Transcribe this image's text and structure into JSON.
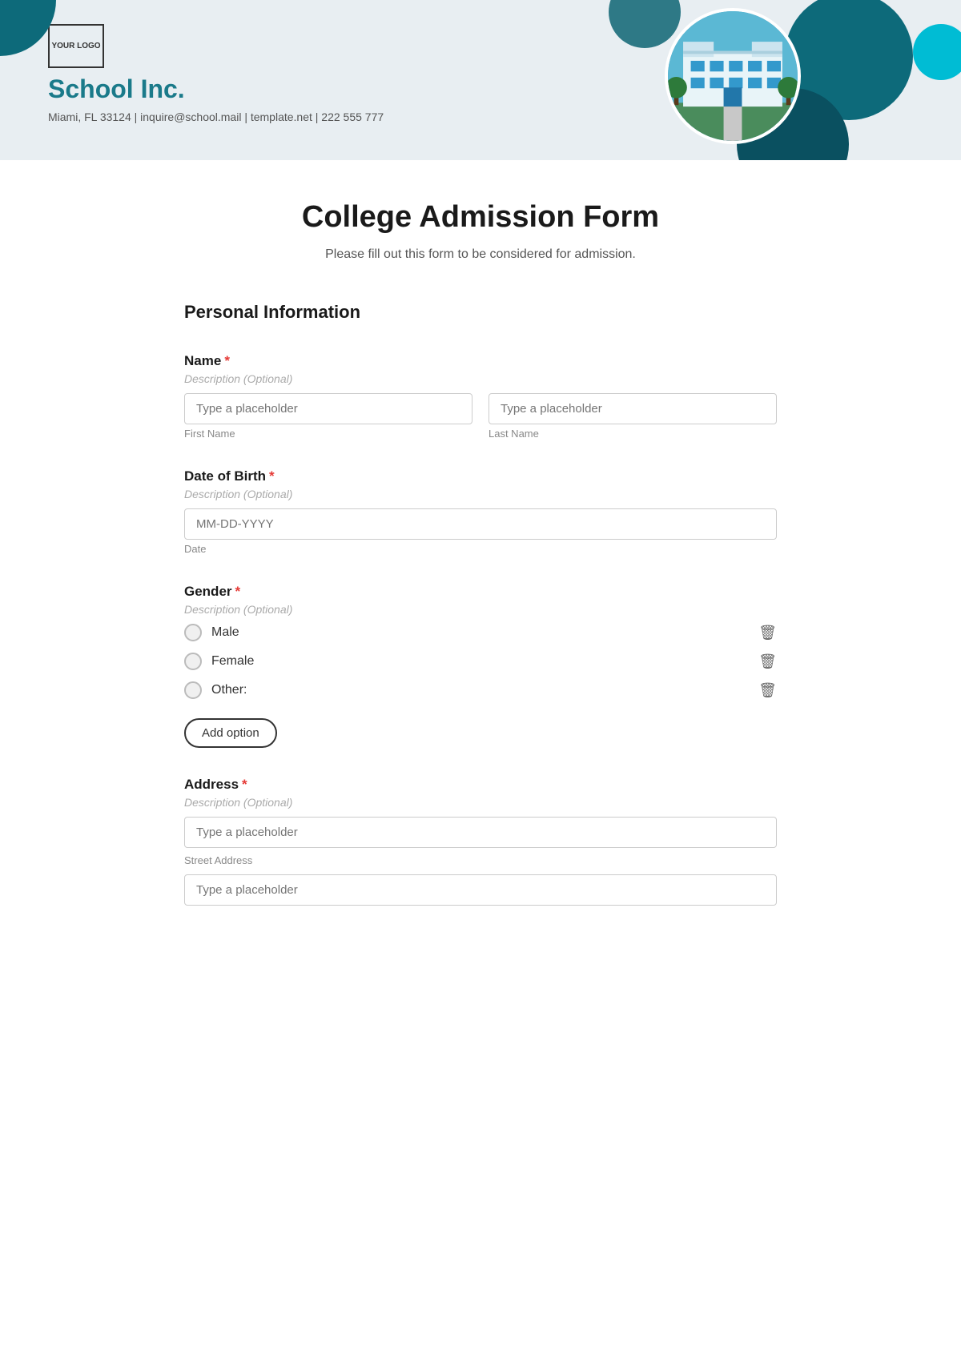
{
  "header": {
    "logo_text": "YOUR\nLOGO",
    "school_name": "School Inc.",
    "contact": "Miami, FL 33124 | inquire@school.mail | template.net | 222 555 777"
  },
  "form": {
    "title": "College Admission Form",
    "subtitle": "Please fill out this form to be considered for admission.",
    "section_personal": "Personal Information",
    "fields": {
      "name": {
        "label": "Name",
        "required": true,
        "description": "Description (Optional)",
        "first_placeholder": "Type a placeholder",
        "last_placeholder": "Type a placeholder",
        "first_hint": "First Name",
        "last_hint": "Last Name"
      },
      "dob": {
        "label": "Date of Birth",
        "required": true,
        "description": "Description (Optional)",
        "placeholder": "MM-DD-YYYY",
        "hint": "Date"
      },
      "gender": {
        "label": "Gender",
        "required": true,
        "description": "Description (Optional)",
        "options": [
          "Male",
          "Female",
          "Other:"
        ],
        "add_option_label": "Add option"
      },
      "address": {
        "label": "Address",
        "required": true,
        "description": "Description (Optional)",
        "placeholder": "Type a placeholder",
        "hint": "Street Address",
        "placeholder2": "Type a placeholder"
      }
    }
  }
}
